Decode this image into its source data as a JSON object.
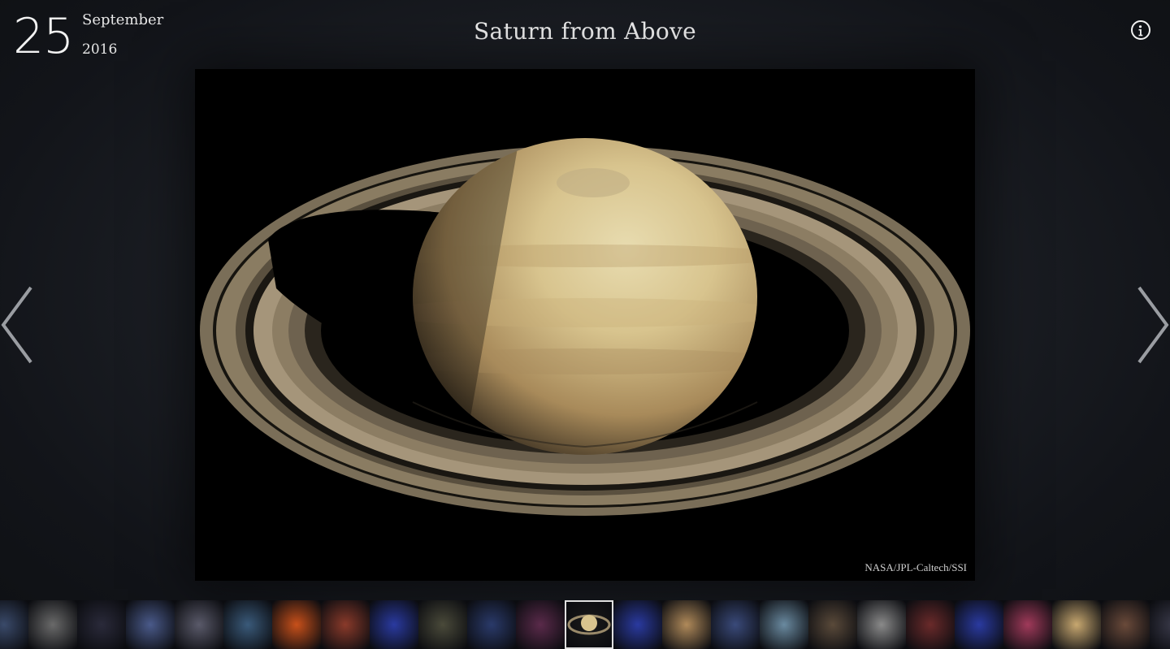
{
  "date": {
    "day": "25",
    "month": "September",
    "year": "2016"
  },
  "title": "Saturn from Above",
  "image": {
    "credit": "NASA/JPL-Caltech/SSI",
    "subject": "saturn"
  },
  "navigation": {
    "prev_icon": "chevron-left-icon",
    "next_icon": "chevron-right-icon",
    "info_icon": "info-icon"
  },
  "thumbnails": [
    {
      "subject": "spiral-galaxy",
      "color": "#3a4a6a"
    },
    {
      "subject": "moon-phases",
      "color": "#6a6a6a"
    },
    {
      "subject": "comet-streak",
      "color": "#2a2a3a"
    },
    {
      "subject": "twilight-landscape",
      "color": "#4a5a8a"
    },
    {
      "subject": "galaxy",
      "color": "#5a5a6a"
    },
    {
      "subject": "starry-night-painting",
      "color": "#3a5a7a"
    },
    {
      "subject": "sun-surface",
      "color": "#c8501a"
    },
    {
      "subject": "helix-nebula",
      "color": "#8a3a2a"
    },
    {
      "subject": "blue-star-cluster",
      "color": "#2a3aa0"
    },
    {
      "subject": "city-night",
      "color": "#4a4a3a"
    },
    {
      "subject": "moon-sequence",
      "color": "#2a3a6a"
    },
    {
      "subject": "red-nebula",
      "color": "#5a2a4a"
    },
    {
      "subject": "saturn",
      "color": "#1a1a1a"
    },
    {
      "subject": "blue-star-cluster",
      "color": "#2a3aa0"
    },
    {
      "subject": "europa-moon",
      "color": "#b08a5a"
    },
    {
      "subject": "bubble-nebula",
      "color": "#3a4a7a"
    },
    {
      "subject": "observatory",
      "color": "#6a8aa0"
    },
    {
      "subject": "rocky-terrain",
      "color": "#5a4a3a"
    },
    {
      "subject": "comet-surface",
      "color": "#8a8a8a"
    },
    {
      "subject": "aurora",
      "color": "#6a2a2a"
    },
    {
      "subject": "blue-star-cluster",
      "color": "#2a3aa0"
    },
    {
      "subject": "pink-nebula",
      "color": "#a03a5a"
    },
    {
      "subject": "desert-rock",
      "color": "#c8a870"
    },
    {
      "subject": "milky-way",
      "color": "#6a4a3a"
    },
    {
      "subject": "dark-sky",
      "color": "#3a3a4a"
    }
  ]
}
